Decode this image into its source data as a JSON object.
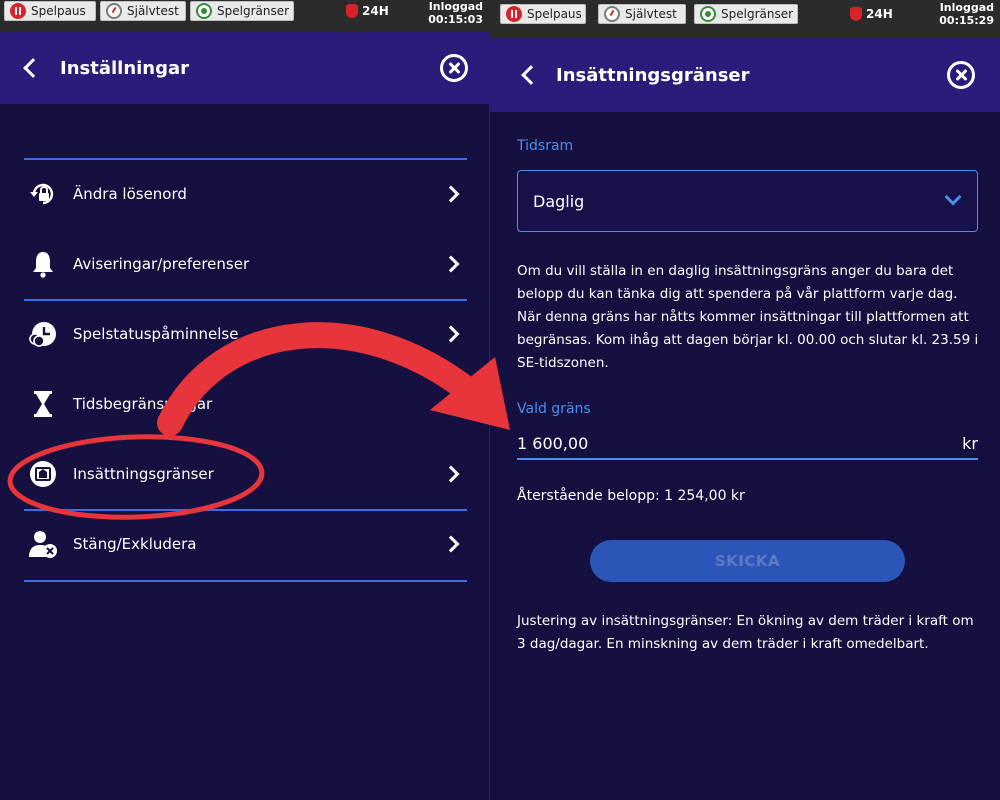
{
  "left": {
    "topbar": {
      "pause_label": "Spelpaus",
      "selftest_label": "Självtest",
      "limits_label": "Spelgränser",
      "timer_badge": "24H",
      "login_label": "Inloggad",
      "login_time": "00:15:03"
    },
    "header": {
      "title": "Inställningar"
    },
    "menu": {
      "items": [
        {
          "label": "Ändra lösenord",
          "icon": "lock-rotate-icon"
        },
        {
          "label": "Aviseringar/preferenser",
          "icon": "bell-icon"
        },
        {
          "label": "Spelstatuspåminnelse",
          "icon": "clock-chips-icon"
        },
        {
          "label": "Tidsbegränsningar",
          "icon": "hourglass-icon"
        },
        {
          "label": "Insättningsgränser",
          "icon": "deposit-icon"
        },
        {
          "label": "Stäng/Exkludera",
          "icon": "user-exclude-icon"
        }
      ]
    }
  },
  "right": {
    "topbar": {
      "pause_label": "Spelpaus",
      "selftest_label": "Självtest",
      "limits_label": "Spelgränser",
      "timer_badge": "24H",
      "login_label": "Inloggad",
      "login_time": "00:15:29"
    },
    "header": {
      "title": "Insättningsgränser"
    },
    "timeframe": {
      "label": "Tidsram",
      "value": "Daglig"
    },
    "description": "Om du vill ställa in en daglig insättningsgräns anger du bara det belopp du kan tänka dig att spendera på vår plattform varje dag. När denna gräns har nåtts kommer insättningar till plattformen att begränsas. Kom ihåg att dagen börjar kl. 00.00 och slutar kl. 23.59 i SE-tidszonen.",
    "limit": {
      "label": "Vald gräns",
      "value": "1 600,00",
      "unit": "kr"
    },
    "remaining": "Återstående belopp: 1 254,00 kr",
    "submit_label": "SKICKA",
    "adjustment_note": "Justering av insättningsgränser: En ökning av dem träder i kraft om 3 dag/dagar. En minskning av dem träder i kraft omedelbart."
  },
  "colors": {
    "background": "#15103f",
    "header": "#2b1c7c",
    "accent": "#4b8ef0",
    "annotation": "#e8353b"
  }
}
